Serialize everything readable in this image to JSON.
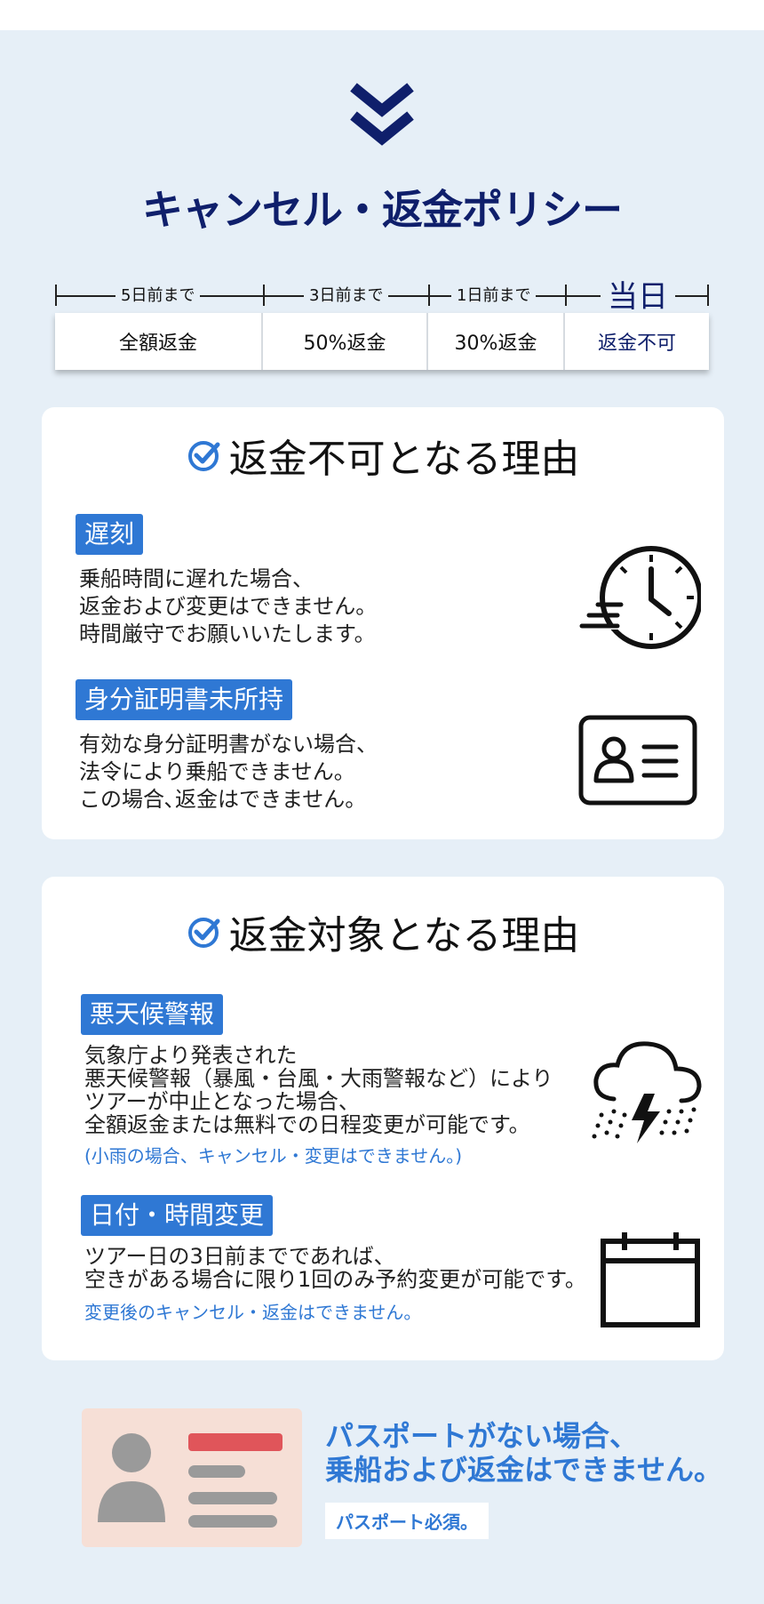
{
  "header": {
    "chevron_icon": "double-chevron-down-icon",
    "title": "キャンセル・返金ポリシー"
  },
  "timeline": {
    "labels": [
      "5日前まで",
      "3日前まで",
      "1日前まで",
      "当日"
    ],
    "tabs": [
      "全額返金",
      "50%返金",
      "30%返金",
      "返金不可"
    ]
  },
  "non_refundable": {
    "title": "返金不可となる理由",
    "items": [
      {
        "tag": "遅刻",
        "lines": [
          "乗船時間に遅れた場合、",
          "返金および変更はできません。",
          "時間厳守でお願いいたします。"
        ],
        "icon": "fast-clock-icon"
      },
      {
        "tag": "身分証明書未所持",
        "lines": [
          "有効な身分証明書がない場合、",
          "法令により乗船できません。",
          "この場合､返金はできません。"
        ],
        "icon": "id-card-icon"
      }
    ]
  },
  "refundable": {
    "title": "返金対象となる理由",
    "items": [
      {
        "tag": "悪天候警報",
        "lines": [
          "気象庁より発表された",
          "悪天候警報（暴風・台風・大雨警報など）により",
          "ツアーが中止となった場合、",
          "全額返金または無料での日程変更が可能です。"
        ],
        "note": "(小雨の場合、キャンセル・変更はできません。)",
        "icon": "storm-cloud-icon"
      },
      {
        "tag": "日付・時間変更",
        "lines": [
          "ツアー日の3日前までであれば、",
          "空きがある場合に限り1回のみ予約変更が可能です。"
        ],
        "note": "変更後のキャンセル・返金はできません。",
        "icon": "calendar-icon"
      }
    ]
  },
  "passport": {
    "line1": "パスポートがない場合、",
    "line2": "乗船および返金はできません。",
    "badge": "パスポート必須。"
  },
  "colors": {
    "navy": "#0f1f6b",
    "blue": "#2f78d4",
    "background": "#e6eff7"
  }
}
